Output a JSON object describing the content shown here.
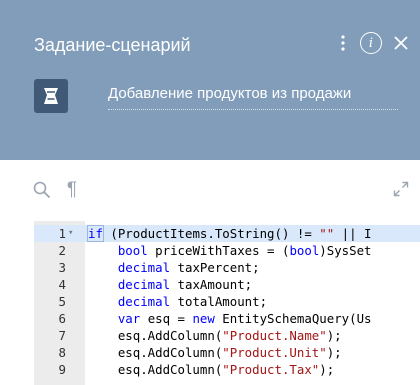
{
  "colors": {
    "header_bg": "#819db9",
    "icon_box": "#3f5977",
    "keyword": "#0000ff",
    "string": "#a31515"
  },
  "header": {
    "title": "Задание-сценарий",
    "subtitle": "Добавление продуктов из продажи",
    "actions": [
      "more-vertical-icon",
      "info-icon",
      "close-icon"
    ]
  },
  "toolbar": {
    "icons": [
      "search-icon",
      "pilcrow-icon",
      "expand-icon"
    ]
  },
  "editor": {
    "lines": [
      {
        "num": "1",
        "fold": "▾",
        "segments": [
          {
            "t": "if",
            "k": "kw"
          },
          {
            "t": " (ProductItems.ToString() != "
          },
          {
            "t": "\"\"",
            "k": "str"
          },
          {
            "t": " || I"
          }
        ]
      },
      {
        "num": "2",
        "segments": [
          {
            "t": "    "
          },
          {
            "t": "bool",
            "k": "kw"
          },
          {
            "t": " priceWithTaxes = ("
          },
          {
            "t": "bool",
            "k": "kw"
          },
          {
            "t": ")SysSet"
          }
        ]
      },
      {
        "num": "3",
        "segments": [
          {
            "t": "    "
          },
          {
            "t": "decimal",
            "k": "kw"
          },
          {
            "t": " taxPercent;"
          }
        ]
      },
      {
        "num": "4",
        "segments": [
          {
            "t": "    "
          },
          {
            "t": "decimal",
            "k": "kw"
          },
          {
            "t": " taxAmount;"
          }
        ]
      },
      {
        "num": "5",
        "segments": [
          {
            "t": "    "
          },
          {
            "t": "decimal",
            "k": "kw"
          },
          {
            "t": " totalAmount;"
          }
        ]
      },
      {
        "num": "6",
        "segments": [
          {
            "t": "    "
          },
          {
            "t": "var",
            "k": "kw"
          },
          {
            "t": " esq = "
          },
          {
            "t": "new",
            "k": "kw"
          },
          {
            "t": " EntitySchemaQuery(Us"
          }
        ]
      },
      {
        "num": "7",
        "segments": [
          {
            "t": "    esq.AddColumn("
          },
          {
            "t": "\"Product.Name\"",
            "k": "str"
          },
          {
            "t": ");"
          }
        ]
      },
      {
        "num": "8",
        "segments": [
          {
            "t": "    esq.AddColumn("
          },
          {
            "t": "\"Product.Unit\"",
            "k": "str"
          },
          {
            "t": ");"
          }
        ]
      },
      {
        "num": "9",
        "segments": [
          {
            "t": "    esq.AddColumn("
          },
          {
            "t": "\"Product.Tax\"",
            "k": "str"
          },
          {
            "t": ");"
          }
        ]
      }
    ]
  }
}
